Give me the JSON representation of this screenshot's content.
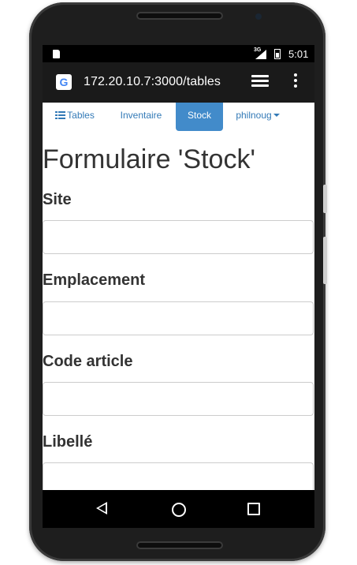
{
  "status_bar": {
    "network": "3G",
    "time": "5:01"
  },
  "browser": {
    "url": "172.20.10.7:3000/tables",
    "favicon": "google-favicon",
    "favicon_letter": "G"
  },
  "navbar": {
    "items": [
      {
        "label": "Tables",
        "icon": "list-icon",
        "active": false
      },
      {
        "label": "Inventaire",
        "active": false
      },
      {
        "label": "Stock",
        "active": true
      },
      {
        "label": "philnoug",
        "icon": "caret-down-icon",
        "active": false
      }
    ]
  },
  "form": {
    "title": "Formulaire 'Stock'",
    "fields": [
      {
        "label": "Site",
        "value": ""
      },
      {
        "label": "Emplacement",
        "value": ""
      },
      {
        "label": "Code article",
        "value": ""
      },
      {
        "label": "Libellé",
        "value": ""
      }
    ]
  },
  "colors": {
    "link": "#337ab7",
    "active_tab": "#428bca",
    "text": "#333333",
    "input_border": "#cccccc"
  }
}
